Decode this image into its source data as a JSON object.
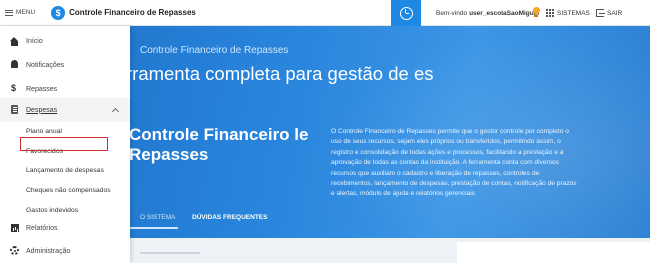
{
  "header": {
    "menu_label": "MENU",
    "brand_logo_glyph": "$",
    "brand_name": "Controle Financeiro de Repasses",
    "welcome_prefix": "Bem-vindo",
    "username": "user_escolaSaoMiguel",
    "sistemas_label": "SISTEMAS",
    "sair_label": "SAIR",
    "accent_color": "#1e88e5"
  },
  "sidebar": {
    "items": [
      {
        "label": "Início",
        "icon": "home-icon"
      },
      {
        "label": "Notificações",
        "icon": "bell-icon"
      },
      {
        "label": "Repasses",
        "icon": "dollar-icon"
      },
      {
        "label": "Despesas",
        "icon": "clipboard-icon"
      }
    ],
    "despesas_sub": [
      {
        "label": "Plano anual"
      },
      {
        "label": "Favorecidos"
      },
      {
        "label": "Lançamento de despesas",
        "highlighted": true
      },
      {
        "label": "Cheques não compensados"
      },
      {
        "label": "Gastos indevidos"
      }
    ],
    "bottom_items": [
      {
        "label": "Relatórios",
        "icon": "chart-icon"
      },
      {
        "label": "Administração",
        "icon": "gear-icon"
      }
    ]
  },
  "hero": {
    "subtitle": "Controle Financeiro de Repasses",
    "title": "rramenta completa para gestão de es",
    "title2": "Controle Financeiro le Repasses",
    "description": "O Controle Financeiro de Repasses permite que o gestor controle por completo o uso de seus recursos, sejam eles próprios ou transferidos, permitindo assim, o registro e consolidação de todas ações e processos, facilitando a prestação e a aprovação de todas as contas da instituição. A ferramenta conta com diversos recursos que auxiliam o cadastro e liberação de repasses, controles de recebimentos, lançamento de despesas, prestação de contas, notificação de prazos e alertas, módulo de ajuda e relatórios gerenciais",
    "tabs": [
      "O SISTEMA",
      "DÚVIDAS FREQUENTES"
    ]
  }
}
